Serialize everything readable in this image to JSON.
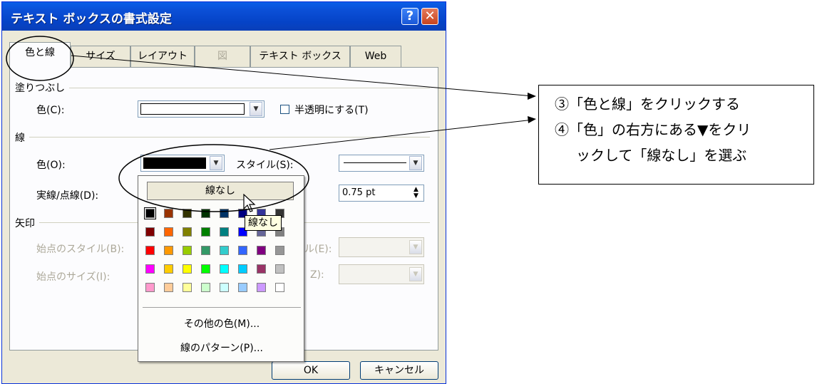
{
  "dialog": {
    "title": "テキスト ボックスの書式設定",
    "help_label": "?",
    "close_label": "✕"
  },
  "tabs": [
    {
      "label": "色と線",
      "active": true
    },
    {
      "label": "サイズ"
    },
    {
      "label": "レイアウト"
    },
    {
      "label": "図",
      "disabled": true
    },
    {
      "label": "テキスト ボックス"
    },
    {
      "label": "Web"
    }
  ],
  "fill": {
    "group": "塗りつぶし",
    "color_label": "色(C):",
    "color_value": "#ffffff",
    "transparent_label": "半透明にする(T)"
  },
  "line": {
    "group": "線",
    "color_label": "色(O):",
    "color_value": "#000000",
    "style_label": "スタイル(S):",
    "dash_label": "実線/点線(D):",
    "weight_value": "0.75 pt"
  },
  "arrows": {
    "group": "矢印",
    "begin_style_label": "始点のスタイル(B):",
    "begin_size_label": "始点のサイズ(I):",
    "end_style_label_partial": "ル(E):",
    "end_size_label_partial": "Z):"
  },
  "popup": {
    "no_line_label": "線なし",
    "tooltip": "線なし",
    "more_colors": "その他の色(M)...",
    "patterns": "線のパターン(P)...",
    "swatches": [
      [
        "#000000",
        "#993300",
        "#333300",
        "#003300",
        "#003366",
        "#000080",
        "#333399",
        "#333333"
      ],
      [
        "#800000",
        "#ff6600",
        "#808000",
        "#008000",
        "#008080",
        "#0000ff",
        "#666699",
        "#808080"
      ],
      [
        "#ff0000",
        "#ff9900",
        "#99cc00",
        "#339966",
        "#33cccc",
        "#3366ff",
        "#800080",
        "#969696"
      ],
      [
        "#ff00ff",
        "#ffcc00",
        "#ffff00",
        "#00ff00",
        "#00ffff",
        "#00ccff",
        "#993366",
        "#c0c0c0"
      ],
      [
        "#ff99cc",
        "#ffcc99",
        "#ffff99",
        "#ccffcc",
        "#ccffff",
        "#99ccff",
        "#cc99ff",
        "#ffffff"
      ]
    ]
  },
  "buttons": {
    "ok": "OK",
    "cancel": "キャンセル"
  },
  "annotations": {
    "step3": "③「色と線」をクリックする",
    "step4_line1": "④「色」の右方にある▼をクリ",
    "step4_line2": "ックして「線なし」を選ぶ"
  }
}
